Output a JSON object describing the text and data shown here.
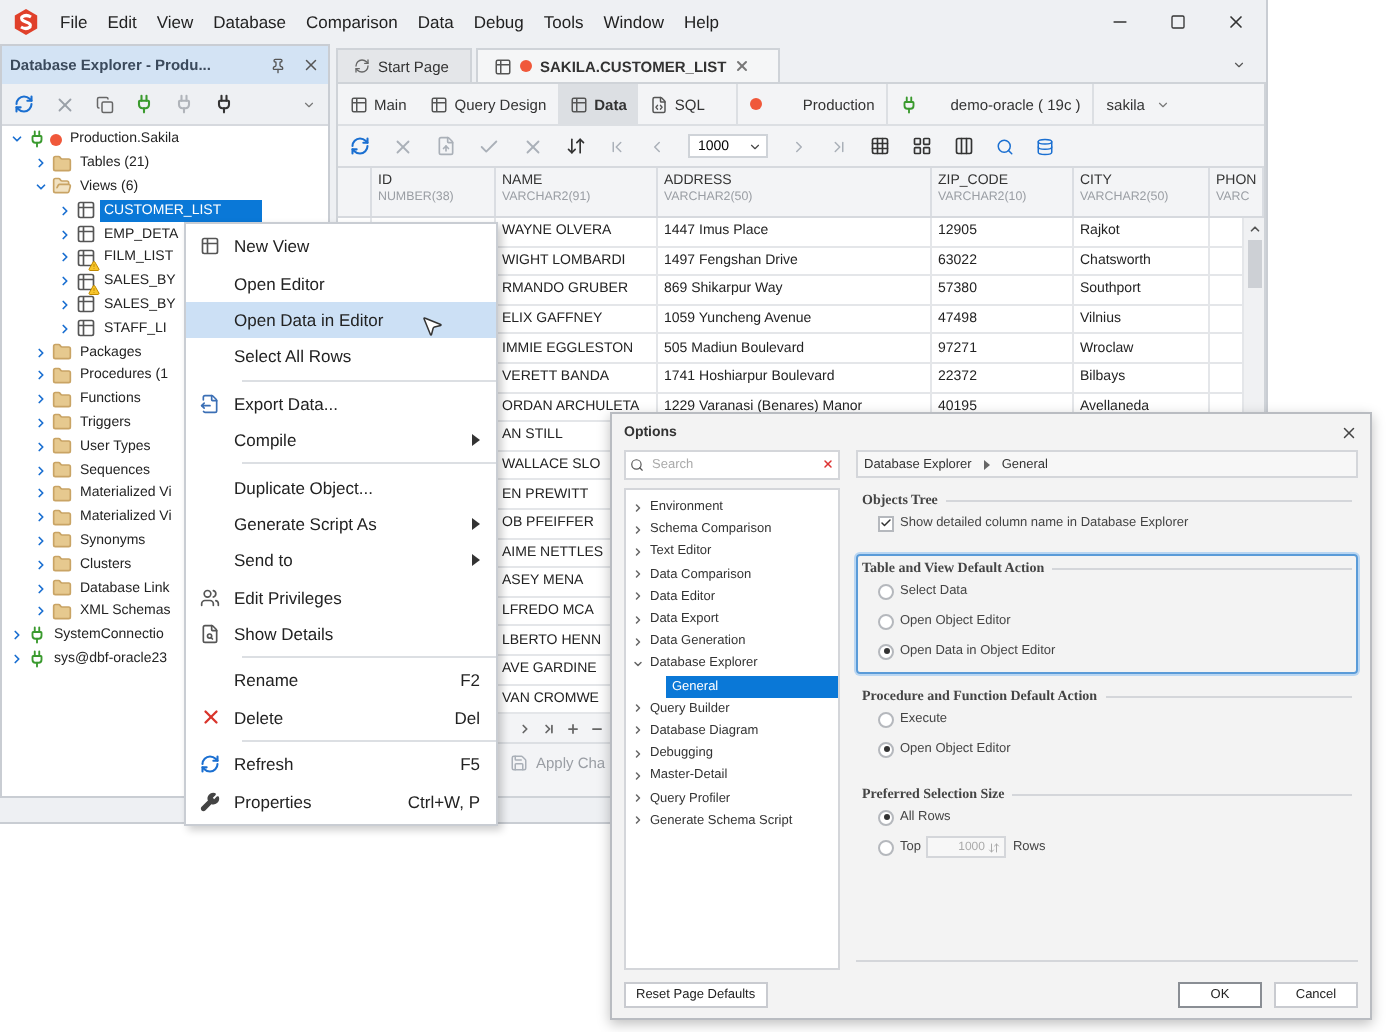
{
  "menu_bar": [
    "File",
    "Edit",
    "View",
    "Database",
    "Comparison",
    "Data",
    "Debug",
    "Tools",
    "Window",
    "Help"
  ],
  "explorer": {
    "title": "Database Explorer - Produ...",
    "tree": [
      {
        "label": "Production.Sakila",
        "kind": "connection",
        "color": "#f0583a",
        "expanded": true,
        "selected": false,
        "children": [
          {
            "label": "Tables (21)",
            "kind": "folder",
            "expanded": false,
            "selected": false
          },
          {
            "label": "Views (6)",
            "kind": "folder_open",
            "expanded": true,
            "selected": false,
            "children": [
              {
                "label": "CUSTOMER_LIST",
                "kind": "view",
                "warning": false,
                "expanded": false,
                "selected": true
              },
              {
                "label": "EMP_DETA",
                "kind": "view",
                "warning": false,
                "expanded": false,
                "selected": false
              },
              {
                "label": "FILM_LIST",
                "kind": "view",
                "warning": true,
                "expanded": false,
                "selected": false
              },
              {
                "label": "SALES_BY",
                "kind": "view",
                "warning": true,
                "expanded": false,
                "selected": false
              },
              {
                "label": "SALES_BY",
                "kind": "view",
                "warning": false,
                "expanded": false,
                "selected": false
              },
              {
                "label": "STAFF_LI",
                "kind": "view",
                "warning": false,
                "expanded": false,
                "selected": false
              }
            ]
          },
          {
            "label": "Packages",
            "kind": "folder",
            "expanded": false,
            "selected": false
          },
          {
            "label": "Procedures (1",
            "kind": "folder",
            "expanded": false,
            "selected": false
          },
          {
            "label": "Functions",
            "kind": "folder",
            "expanded": false,
            "selected": false
          },
          {
            "label": "Triggers",
            "kind": "folder",
            "expanded": false,
            "selected": false
          },
          {
            "label": "User Types",
            "kind": "folder",
            "expanded": false,
            "selected": false
          },
          {
            "label": "Sequences",
            "kind": "folder",
            "expanded": false,
            "selected": false
          },
          {
            "label": "Materialized Vi",
            "kind": "folder",
            "expanded": false,
            "selected": false
          },
          {
            "label": "Materialized Vi",
            "kind": "folder",
            "expanded": false,
            "selected": false
          },
          {
            "label": "Synonyms",
            "kind": "folder",
            "expanded": false,
            "selected": false
          },
          {
            "label": "Clusters",
            "kind": "folder",
            "expanded": false,
            "selected": false
          },
          {
            "label": "Database Link",
            "kind": "folder",
            "expanded": false,
            "selected": false
          },
          {
            "label": "XML Schemas",
            "kind": "folder",
            "expanded": false,
            "selected": false
          }
        ]
      },
      {
        "label": "SystemConnectio",
        "kind": "connection",
        "expanded": false,
        "selected": false
      },
      {
        "label": "sys@dbf-oracle23",
        "kind": "connection",
        "expanded": false,
        "selected": false
      }
    ]
  },
  "doc_tabs": [
    {
      "label": "Start Page",
      "selected": false
    },
    {
      "label": "SAKILA.CUSTOMER_LIST",
      "selected": true
    }
  ],
  "sub_tabs": [
    {
      "label": "Main",
      "selected": false
    },
    {
      "label": "Query Design",
      "selected": false
    },
    {
      "label": "Data",
      "selected": true
    },
    {
      "label": "SQL",
      "selected": false
    }
  ],
  "connection": {
    "environment": "Production",
    "color": "#f0583a",
    "server": "demo-oracle ( 19c )",
    "schema": "sakila"
  },
  "page_size": "1000",
  "columns": [
    {
      "name": "ID",
      "type": "NUMBER(38)"
    },
    {
      "name": "NAME",
      "type": "VARCHAR2(91)"
    },
    {
      "name": "ADDRESS",
      "type": "VARCHAR2(50)"
    },
    {
      "name": "ZIP_CODE",
      "type": "VARCHAR2(10)"
    },
    {
      "name": "CITY",
      "type": "VARCHAR2(50)"
    },
    {
      "name": "PHON",
      "type": "VARC"
    }
  ],
  "rows": [
    {
      "name": "WAYNE OLVERA",
      "address": "1447 Imus Place",
      "zip_code": "12905",
      "city": "Rajkot"
    },
    {
      "name": "WIGHT LOMBARDI",
      "address": "1497 Fengshan Drive",
      "zip_code": "63022",
      "city": "Chatsworth"
    },
    {
      "name": "RMANDO GRUBER",
      "address": "869 Shikarpur Way",
      "zip_code": "57380",
      "city": "Southport"
    },
    {
      "name": "ELIX GAFFNEY",
      "address": "1059 Yuncheng Avenue",
      "zip_code": "47498",
      "city": "Vilnius"
    },
    {
      "name": "IMMIE EGGLESTON",
      "address": "505 Madiun Boulevard",
      "zip_code": "97271",
      "city": "Wroclaw"
    },
    {
      "name": "VERETT BANDA",
      "address": "1741 Hoshiarpur Boulevard",
      "zip_code": "22372",
      "city": "Bilbays"
    },
    {
      "name": "ORDAN ARCHULETA",
      "address": "1229 Varanasi (Benares) Manor",
      "zip_code": "40195",
      "city": "Avellaneda"
    },
    {
      "name": "AN STILL"
    },
    {
      "name": "WALLACE SLO"
    },
    {
      "name": "EN PREWITT"
    },
    {
      "name": "OB PFEIFFER"
    },
    {
      "name": "AIME NETTLES"
    },
    {
      "name": "ASEY MENA"
    },
    {
      "name": "LFREDO MCA"
    },
    {
      "name": "LBERTO HENN"
    },
    {
      "name": "AVE GARDINE"
    },
    {
      "name": "VAN CROMWE"
    }
  ],
  "apply_button": "Apply Cha",
  "context_menu": [
    [
      {
        "label": "New View",
        "kind": "view",
        "highlighted": false
      },
      {
        "label": "Open Editor",
        "kind": "plain",
        "highlighted": false
      },
      {
        "label": "Open Data in Editor",
        "kind": "plain",
        "highlighted": true
      },
      {
        "label": "Select All Rows",
        "kind": "plain",
        "highlighted": false
      }
    ],
    [
      {
        "label": "Export Data...",
        "kind": "export",
        "highlighted": false
      },
      {
        "label": "Compile",
        "kind": "plain",
        "submenu": true,
        "highlighted": false
      }
    ],
    [
      {
        "label": "Duplicate Object...",
        "kind": "plain",
        "highlighted": false
      },
      {
        "label": "Generate Script As",
        "kind": "plain",
        "submenu": true,
        "highlighted": false
      },
      {
        "label": "Send to",
        "kind": "plain",
        "submenu": true,
        "highlighted": false
      },
      {
        "label": "Edit Privileges",
        "kind": "privileges",
        "highlighted": false
      },
      {
        "label": "Show Details",
        "kind": "details",
        "highlighted": false
      }
    ],
    [
      {
        "label": "Rename",
        "kind": "plain",
        "shortcut": "F2",
        "highlighted": false
      },
      {
        "label": "Delete",
        "kind": "delete",
        "shortcut": "Del",
        "highlighted": false
      }
    ],
    [
      {
        "label": "Refresh",
        "kind": "refresh",
        "shortcut": "F5",
        "highlighted": false
      },
      {
        "label": "Properties",
        "kind": "properties",
        "shortcut": "Ctrl+W, P",
        "highlighted": false
      }
    ]
  ],
  "options": {
    "title": "Options",
    "search": {
      "placeholder": "Search"
    },
    "tree": [
      {
        "label": "Environment",
        "expanded": false,
        "selected": false
      },
      {
        "label": "Schema Comparison",
        "expanded": false,
        "selected": false
      },
      {
        "label": "Text Editor",
        "expanded": false,
        "selected": false
      },
      {
        "label": "Data Comparison",
        "expanded": false,
        "selected": false
      },
      {
        "label": "Data Editor",
        "expanded": false,
        "selected": false
      },
      {
        "label": "Data Export",
        "expanded": false,
        "selected": false
      },
      {
        "label": "Data Generation",
        "expanded": false,
        "selected": false
      },
      {
        "label": "Database Explorer",
        "expanded": true,
        "selected": false,
        "children": [
          {
            "label": "General",
            "selected": true
          }
        ]
      },
      {
        "label": "Query Builder",
        "expanded": false,
        "selected": false
      },
      {
        "label": "Database Diagram",
        "expanded": false,
        "selected": false
      },
      {
        "label": "Debugging",
        "expanded": false,
        "selected": false
      },
      {
        "label": "Master-Detail",
        "expanded": false,
        "selected": false
      },
      {
        "label": "Query Profiler",
        "expanded": false,
        "selected": false
      },
      {
        "label": "Generate Schema Script",
        "expanded": false,
        "selected": false
      }
    ],
    "breadcrumb": [
      "Database Explorer",
      "General"
    ],
    "sections": [
      {
        "title": "Objects Tree",
        "focused": false,
        "items": [
          {
            "kind": "checkbox",
            "label": "Show detailed column name in Database Explorer",
            "checked": true
          }
        ]
      },
      {
        "title": "Table and View Default Action",
        "focused": true,
        "items": [
          {
            "kind": "radio",
            "label": "Select Data",
            "selected": false
          },
          {
            "kind": "radio",
            "label": "Open Object Editor",
            "selected": false
          },
          {
            "kind": "radio",
            "label": "Open Data in Object Editor",
            "selected": true
          }
        ]
      },
      {
        "title": "Procedure and Function Default Action",
        "focused": false,
        "items": [
          {
            "kind": "radio",
            "label": "Execute",
            "selected": false
          },
          {
            "kind": "radio",
            "label": "Open Object Editor",
            "selected": true
          }
        ]
      },
      {
        "title": "Preferred Selection Size",
        "focused": false,
        "items": [
          {
            "kind": "radio",
            "label": "All Rows",
            "selected": true
          },
          {
            "kind": "radio_count",
            "label": "Top",
            "value": "1000",
            "suffix": "Rows",
            "selected": false
          }
        ]
      }
    ],
    "reset_button": "Reset Page Defaults",
    "ok_button": "OK",
    "cancel_button": "Cancel"
  }
}
